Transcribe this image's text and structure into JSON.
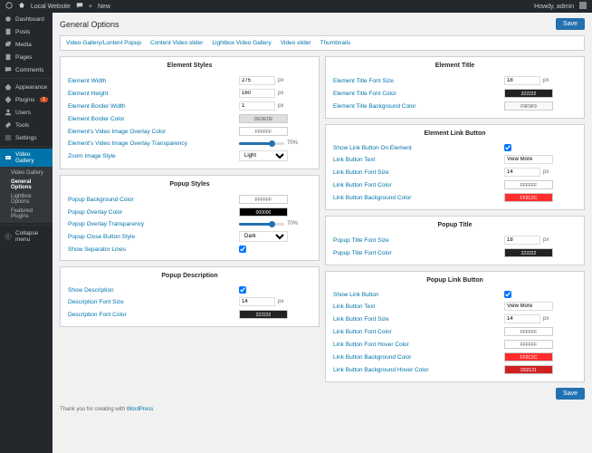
{
  "toolbar": {
    "site": "Local Website",
    "new": "New",
    "howdy": "Howdy, admin"
  },
  "sidebar": {
    "items": [
      {
        "label": "Dashboard"
      },
      {
        "label": "Posts"
      },
      {
        "label": "Media"
      },
      {
        "label": "Pages"
      },
      {
        "label": "Comments"
      },
      {
        "label": "Appearance"
      },
      {
        "label": "Plugins",
        "badge": "1"
      },
      {
        "label": "Users"
      },
      {
        "label": "Tools"
      },
      {
        "label": "Settings"
      }
    ],
    "gallery_label": "Video Gallery",
    "sub": [
      {
        "label": "Video Gallery"
      },
      {
        "label": "General Options"
      },
      {
        "label": "Lightbox Options"
      },
      {
        "label": "Featured Plugins"
      }
    ],
    "collapse": "Collapse menu"
  },
  "page": {
    "title": "General Options",
    "save": "Save"
  },
  "tabs": [
    "Video Gallery/Lontent Popup",
    "Content Video slider",
    "Lightbox Video Gallery",
    "Video slider",
    "Thumbnails"
  ],
  "panels": {
    "element_styles": {
      "title": "Element Styles",
      "width": {
        "label": "Element Width",
        "value": "275",
        "unit": "px"
      },
      "height": {
        "label": "Element Height",
        "value": "160",
        "unit": "px"
      },
      "border_w": {
        "label": "Element Border Width",
        "value": "1",
        "unit": "px"
      },
      "border_c": {
        "label": "Element Border Color",
        "value": "DEDEDE",
        "hex": "#DEDEDE"
      },
      "overlay_c": {
        "label": "Element's Video Image Overlay Color",
        "value": "FFFFFF",
        "hex": "#FFFFFF"
      },
      "overlay_t": {
        "label": "Element's Video Image Overlay Transparency",
        "value": "70%",
        "pct": 70
      },
      "zoom": {
        "label": "Zoom Image Style",
        "value": "Light"
      }
    },
    "popup_styles": {
      "title": "Popup Styles",
      "bg": {
        "label": "Popup Background Color",
        "value": "FFFFFF",
        "hex": "#FFFFFF"
      },
      "ov_c": {
        "label": "Popup Overlay Color",
        "value": "000000",
        "hex": "#000000"
      },
      "ov_t": {
        "label": "Popup Overlay Transparency",
        "value": "70%",
        "pct": 70
      },
      "close": {
        "label": "Popup Close Button Style",
        "value": "Dark"
      },
      "sep": {
        "label": "Show Separator Lines"
      }
    },
    "popup_desc": {
      "title": "Popup Description",
      "show": {
        "label": "Show Description"
      },
      "size": {
        "label": "Description Font Size",
        "value": "14",
        "unit": "px"
      },
      "color": {
        "label": "Description Font Color",
        "value": "222222",
        "hex": "#222222"
      }
    },
    "element_title": {
      "title": "Element Title",
      "size": {
        "label": "Element Title Font Size",
        "value": "18",
        "unit": "px"
      },
      "color": {
        "label": "Element Title Font Color",
        "value": "222222",
        "hex": "#222222"
      },
      "bg": {
        "label": "Element Title Background Color",
        "value": "F9F9F9",
        "hex": "#F9F9F9"
      }
    },
    "link_btn": {
      "title": "Element Link Button",
      "show": {
        "label": "Show Link Button On Element"
      },
      "text": {
        "label": "Link Button Text",
        "value": "View More"
      },
      "size": {
        "label": "Link Button Font Size",
        "value": "14",
        "unit": "px"
      },
      "color": {
        "label": "Link Button Font Color",
        "value": "FFFFFF",
        "hex": "#FFFFFF"
      },
      "bg": {
        "label": "Link Button Background Color",
        "value": "FF2C2C",
        "hex": "#FF2C2C"
      }
    },
    "popup_title": {
      "title": "Popup Title",
      "size": {
        "label": "Popup Title Font Size",
        "value": "18",
        "unit": "px"
      },
      "color": {
        "label": "Popup Title Font Color",
        "value": "222222",
        "hex": "#222222"
      }
    },
    "popup_link": {
      "title": "Popup Link Button",
      "show": {
        "label": "Show Link Button"
      },
      "text": {
        "label": "Link Button Text",
        "value": "View More"
      },
      "size": {
        "label": "Link Button Font Size",
        "value": "14",
        "unit": "px"
      },
      "color": {
        "label": "Link Button Font Color",
        "value": "FFFFFF",
        "hex": "#FFFFFF"
      },
      "hcolor": {
        "label": "Link Button Font Hover Color",
        "value": "FFFFFF",
        "hex": "#FFFFFF"
      },
      "bg": {
        "label": "Link Button Background Color",
        "value": "FF2C2C",
        "hex": "#FF2C2C"
      },
      "hbg": {
        "label": "Link Button Background Hover Color",
        "value": "D02121",
        "hex": "#D02121"
      }
    }
  },
  "footer": {
    "note": "Thank you for creating with ",
    "link": "WordPress"
  }
}
